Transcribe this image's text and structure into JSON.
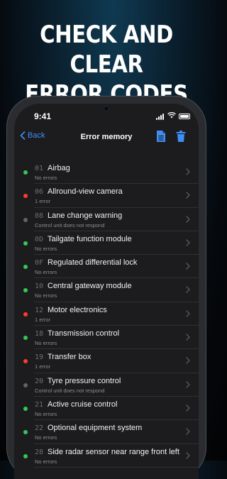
{
  "promo": {
    "headline_line1": "CHECK AND CLEAR",
    "headline_line2": "ERROR CODES"
  },
  "status_bar": {
    "time": "9:41"
  },
  "nav": {
    "back_label": "Back",
    "title": "Error memory",
    "accent_color": "#3e8ef7"
  },
  "colors": {
    "green": "#34c759",
    "red": "#ff3b30",
    "gray": "#636366"
  },
  "modules": [
    {
      "code": "01",
      "name": "Airbag",
      "status": "No errors",
      "indicator": "green"
    },
    {
      "code": "06",
      "name": "Allround-view camera",
      "status": "1 error",
      "indicator": "red"
    },
    {
      "code": "08",
      "name": "Lane change warning",
      "status": "Control unit does not respond",
      "indicator": "gray"
    },
    {
      "code": "0D",
      "name": "Tailgate function module",
      "status": "No errors",
      "indicator": "green"
    },
    {
      "code": "0F",
      "name": "Regulated differential lock",
      "status": "No errors",
      "indicator": "green"
    },
    {
      "code": "10",
      "name": "Central gateway module",
      "status": "No errors",
      "indicator": "green"
    },
    {
      "code": "12",
      "name": "Motor electronics",
      "status": "1 error",
      "indicator": "red"
    },
    {
      "code": "18",
      "name": "Transmission control",
      "status": "No errors",
      "indicator": "green"
    },
    {
      "code": "19",
      "name": "Transfer box",
      "status": "1 error",
      "indicator": "red"
    },
    {
      "code": "20",
      "name": "Tyre pressure control",
      "status": "Control unit does not respond",
      "indicator": "gray"
    },
    {
      "code": "21",
      "name": "Active cruise control",
      "status": "No errors",
      "indicator": "green"
    },
    {
      "code": "22",
      "name": "Optional equipment system",
      "status": "No errors",
      "indicator": "green"
    },
    {
      "code": "28",
      "name": "Side radar sensor near range front left",
      "status": "No errors",
      "indicator": "green"
    }
  ]
}
